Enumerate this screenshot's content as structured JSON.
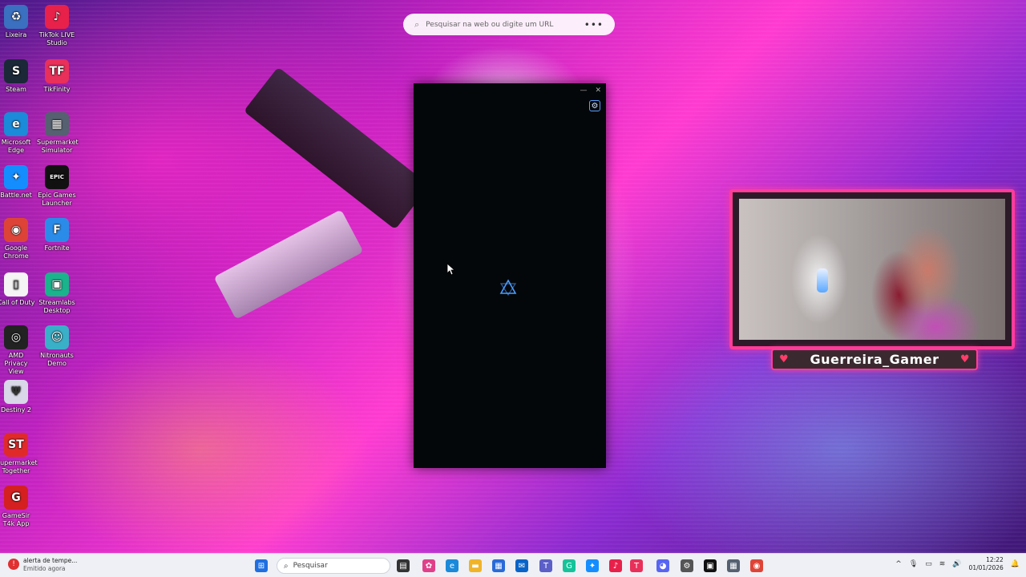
{
  "desktop_icons": [
    {
      "label": "Lixeira",
      "glyph": "♻",
      "color": "#3b6fbf"
    },
    {
      "label": "TikTok LIVE Studio",
      "glyph": "♪",
      "color": "#e8214a"
    },
    {
      "label": "Steam",
      "glyph": "S",
      "color": "#1b2838"
    },
    {
      "label": "TikFinity",
      "glyph": "TF",
      "color": "#e8305a"
    },
    {
      "label": "Microsoft Edge",
      "glyph": "e",
      "color": "#1b8ad8"
    },
    {
      "label": "Supermarket Simulator",
      "glyph": "▦",
      "color": "#556070"
    },
    {
      "label": "Battle.net",
      "glyph": "✦",
      "color": "#148eff"
    },
    {
      "label": "Epic Games Launcher",
      "glyph": "EPIC",
      "color": "#111111"
    },
    {
      "label": "Google Chrome",
      "glyph": "◉",
      "color": "#dd4437"
    },
    {
      "label": "Fortnite",
      "glyph": "F",
      "color": "#2a8ce8"
    },
    {
      "label": "Call of Duty",
      "glyph": "▯",
      "color": "#f4f4f4"
    },
    {
      "label": "Streamlabs Desktop",
      "glyph": "▣",
      "color": "#19b38c"
    },
    {
      "label": "AMD Privacy View",
      "glyph": "◎",
      "color": "#222222"
    },
    {
      "label": "Nitronauts Demo",
      "glyph": "☺",
      "color": "#3ab0c8"
    },
    {
      "label": "Destiny 2",
      "glyph": "Ψ",
      "color": "#d8d8e8"
    },
    {
      "label": "Supermarket Together",
      "glyph": "ST",
      "color": "#e02a2a"
    },
    {
      "label": "GameSir T4k App",
      "glyph": "G",
      "color": "#d42020"
    }
  ],
  "top_search": {
    "placeholder": "Pesquisar na web ou digite um URL",
    "menu": "•••"
  },
  "app_window": {
    "minimize": "—",
    "close": "✕",
    "settings": "⚙"
  },
  "webcam": {
    "name": "Guerreira_Gamer"
  },
  "taskbar": {
    "notification_title": "alerta de tempe...",
    "notification_sub": "Emitido agora",
    "search_placeholder": "Pesquisar",
    "apps": [
      {
        "name": "start",
        "glyph": "⊞",
        "color": "#1f6fe0"
      },
      {
        "name": "task-view",
        "glyph": "▤",
        "color": "#333333"
      },
      {
        "name": "copilot",
        "glyph": "✿",
        "color": "#e0408a"
      },
      {
        "name": "edge",
        "glyph": "e",
        "color": "#1b8ad8"
      },
      {
        "name": "explorer",
        "glyph": "▬",
        "color": "#f0b429"
      },
      {
        "name": "store",
        "glyph": "▦",
        "color": "#2a6ad8"
      },
      {
        "name": "outlook",
        "glyph": "✉",
        "color": "#0a64c8"
      },
      {
        "name": "teams",
        "glyph": "T",
        "color": "#5b5fc7"
      },
      {
        "name": "grammarly",
        "glyph": "G",
        "color": "#15c39a"
      },
      {
        "name": "battlenet",
        "glyph": "✦",
        "color": "#148eff"
      },
      {
        "name": "tiktok-studio",
        "glyph": "♪",
        "color": "#e8214a"
      },
      {
        "name": "tikfinity",
        "glyph": "T",
        "color": "#e8305a"
      },
      {
        "name": "discord",
        "glyph": "◕",
        "color": "#5865f2"
      },
      {
        "name": "settings",
        "glyph": "⚙",
        "color": "#555555"
      },
      {
        "name": "call-of-duty",
        "glyph": "▣",
        "color": "#111111"
      },
      {
        "name": "supermarket",
        "glyph": "▦",
        "color": "#556070"
      },
      {
        "name": "chrome",
        "glyph": "◉",
        "color": "#dd4437"
      }
    ],
    "tray": {
      "chevron": "^",
      "time": "12:22",
      "date": "01/01/2026"
    }
  }
}
